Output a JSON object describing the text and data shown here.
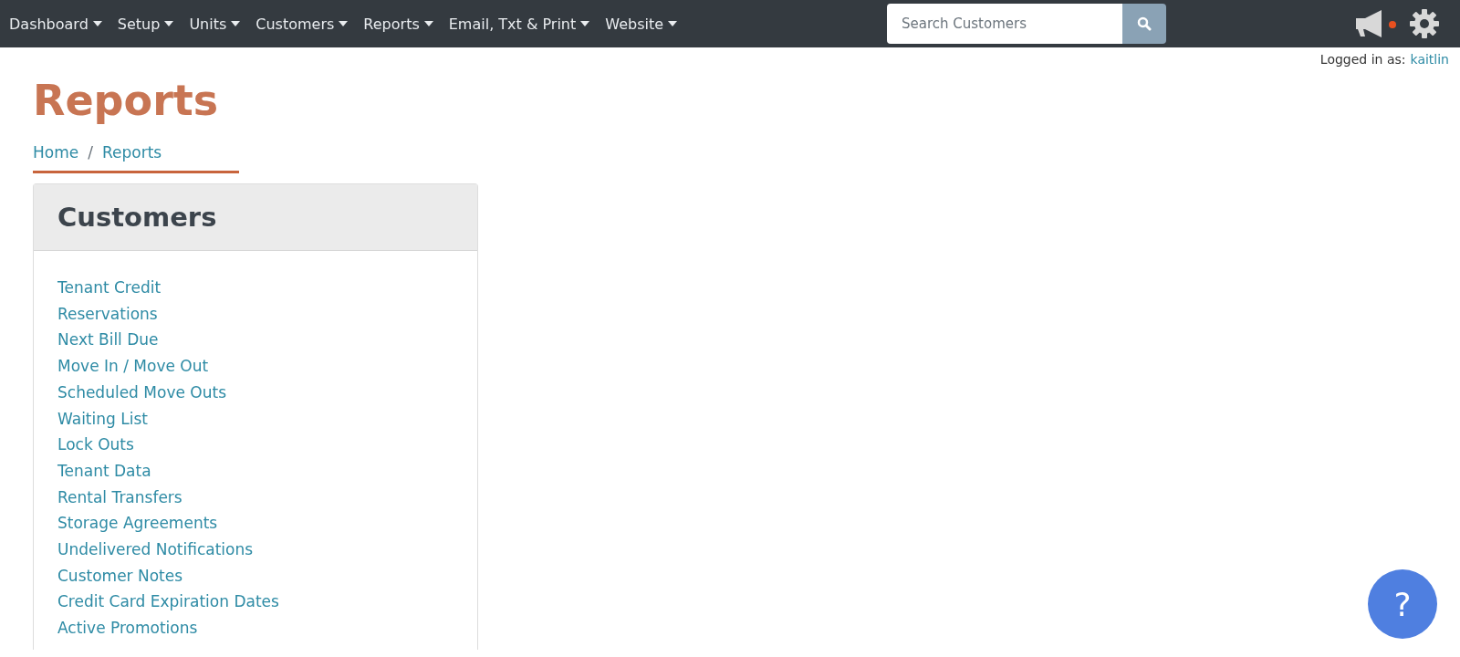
{
  "nav": {
    "menus": [
      {
        "label": "Dashboard"
      },
      {
        "label": "Setup"
      },
      {
        "label": "Units"
      },
      {
        "label": "Customers"
      },
      {
        "label": "Reports"
      },
      {
        "label": "Email, Txt & Print"
      },
      {
        "label": "Website"
      }
    ],
    "search": {
      "placeholder": "Search Customers"
    }
  },
  "login": {
    "label": "Logged in as:",
    "user": "kaitlin"
  },
  "page": {
    "title": "Reports",
    "breadcrumb": [
      "Home",
      "Reports"
    ],
    "breadcrumb_separator": "/"
  },
  "card": {
    "title": "Customers",
    "links": [
      "Tenant Credit",
      "Reservations",
      "Next Bill Due",
      "Move In / Move Out",
      "Scheduled Move Outs",
      "Waiting List",
      "Lock Outs",
      "Tenant Data",
      "Rental Transfers",
      "Storage Agreements",
      "Undelivered Notifications",
      "Customer Notes",
      "Credit Card Expiration Dates",
      "Active Promotions"
    ]
  },
  "help": {
    "label": "?"
  }
}
